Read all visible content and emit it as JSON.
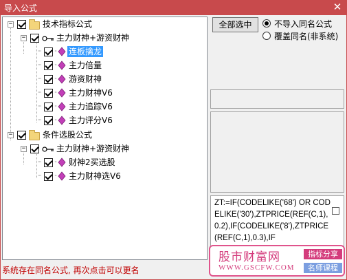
{
  "window": {
    "title": "导入公式",
    "close_glyph": "✕"
  },
  "tree": {
    "groups": [
      {
        "label": "技术指标公式",
        "expander": "−",
        "subgroup": {
          "label": "主力财神+游资财神",
          "expander": "−",
          "items": [
            {
              "label": "连板擒龙",
              "selected": true
            },
            {
              "label": "主力倍量",
              "selected": false
            },
            {
              "label": "游资财神",
              "selected": false
            },
            {
              "label": "主力财神V6",
              "selected": false
            },
            {
              "label": "主力追踪V6",
              "selected": false
            },
            {
              "label": "主力评分V6",
              "selected": false
            }
          ]
        }
      },
      {
        "label": "条件选股公式",
        "expander": "−",
        "subgroup": {
          "label": "主力财神+游资财神",
          "expander": "−",
          "items": [
            {
              "label": "财神2买选股",
              "selected": false
            },
            {
              "label": "主力财神选V6",
              "selected": false
            }
          ]
        }
      }
    ]
  },
  "actions": {
    "select_all_label": "全部选中",
    "options": [
      {
        "label": "不导入同名公式",
        "checked": true
      },
      {
        "label": "覆盖同名(非系统)",
        "checked": false
      }
    ]
  },
  "formula_preview": "ZT:=IF(CODELIKE('68') OR CODELIKE('30'),ZTPRICE(REF(C,1),0.2),IF(CODELIKE('8'),ZTPRICE(REF(C,1),0.3),IF",
  "watermark": {
    "title": "股市财富网",
    "url": "WWW.GSCFW.COM",
    "tag1": "指标分享",
    "tag2": "名师课程"
  },
  "status_text": "系统存在同名公式, 再次点击可以更名",
  "colors": {
    "titlebar": "#c84a4c",
    "selection": "#3399ff",
    "status": "#c00000",
    "watermark": "#d43c7c"
  },
  "icons": [
    "close-icon",
    "folder-icon",
    "key-icon",
    "formula-gem-icon",
    "expander-minus-icon",
    "checkbox-icon"
  ]
}
